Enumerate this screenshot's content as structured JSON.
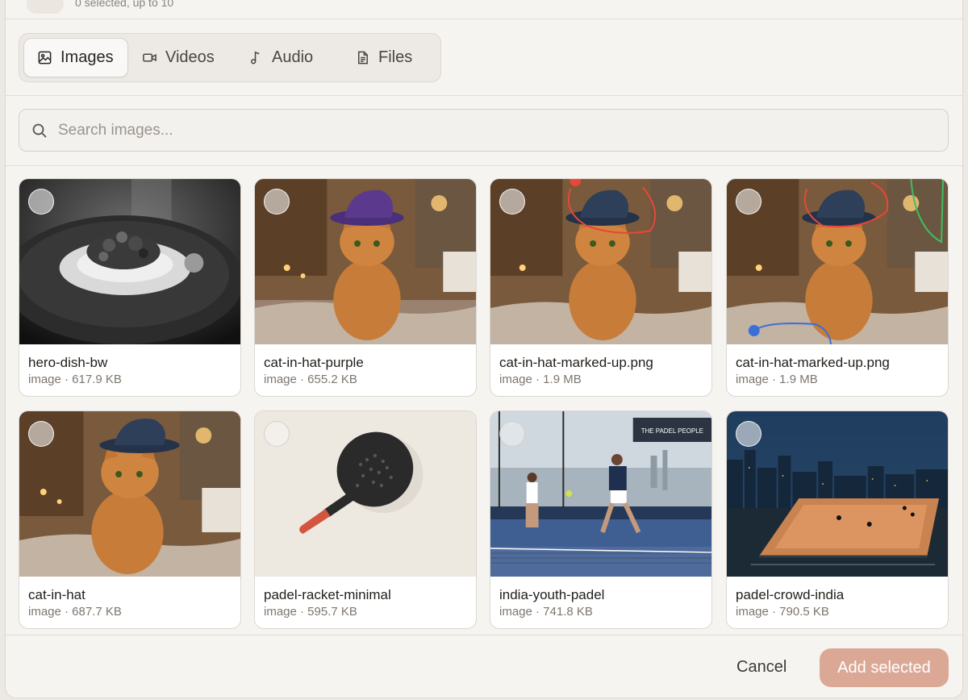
{
  "header": {
    "selection_text": "0 selected, up to 10"
  },
  "tabs": [
    {
      "label": "Images",
      "icon": "image-icon",
      "active": true
    },
    {
      "label": "Videos",
      "icon": "video-icon",
      "active": false
    },
    {
      "label": "Audio",
      "icon": "music-note-icon",
      "active": false
    },
    {
      "label": "Files",
      "icon": "file-icon",
      "active": false
    }
  ],
  "search": {
    "placeholder": "Search images...",
    "value": ""
  },
  "media": [
    {
      "name": "hero-dish-bw",
      "meta": "image · 617.9 KB",
      "thumb": "bw-dish"
    },
    {
      "name": "cat-in-hat-purple",
      "meta": "image · 655.2 KB",
      "thumb": "cat-purple"
    },
    {
      "name": "cat-in-hat-marked-up.png",
      "meta": "image · 1.9 MB",
      "thumb": "cat-markup"
    },
    {
      "name": "cat-in-hat-marked-up.png",
      "meta": "image · 1.9 MB",
      "thumb": "cat-markup-2"
    },
    {
      "name": "cat-in-hat",
      "meta": "image · 687.7 KB",
      "thumb": "cat-navy"
    },
    {
      "name": "padel-racket-minimal",
      "meta": "image · 595.7 KB",
      "thumb": "racket"
    },
    {
      "name": "india-youth-padel",
      "meta": "image · 741.8 KB",
      "thumb": "padel-court"
    },
    {
      "name": "padel-crowd-india",
      "meta": "image · 790.5 KB",
      "thumb": "padel-night"
    }
  ],
  "thumb_text": {
    "padel_brand": "THE PADEL PEOPLE"
  },
  "footer": {
    "cancel_label": "Cancel",
    "add_label": "Add selected"
  },
  "colors": {
    "accent": "#dba896",
    "background": "#f6f4f1"
  }
}
